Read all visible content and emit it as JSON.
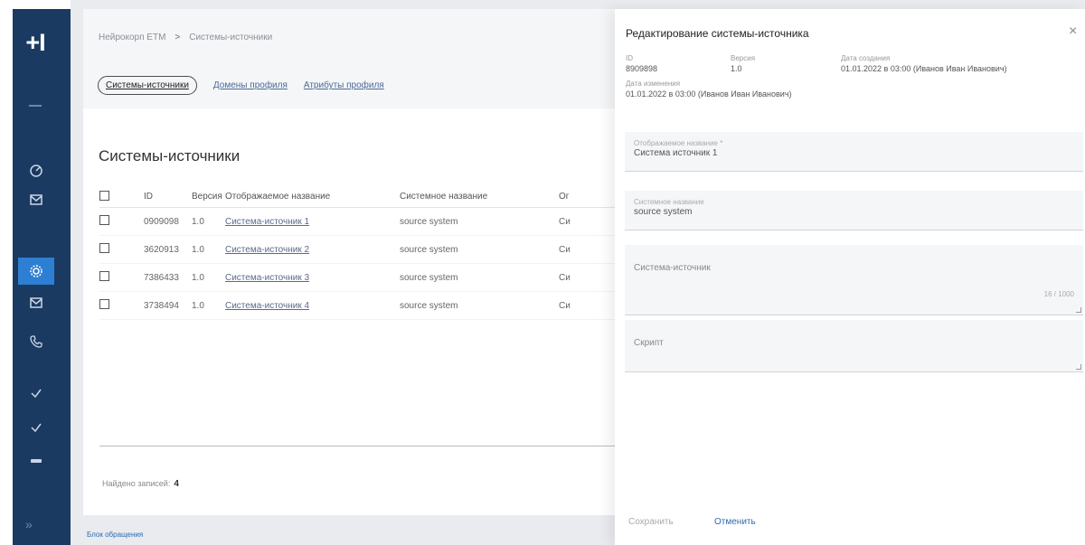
{
  "app": {
    "logo_text": "+I"
  },
  "sidebar": {
    "icons": [
      "dashboard-icon",
      "mail-icon",
      "settings-icon",
      "mail-icon",
      "phone-icon",
      "check-icon",
      "check-icon",
      "minus-icon"
    ],
    "active_index": 2,
    "expand_glyph": "»"
  },
  "breadcrumb": {
    "items": [
      "Нейрокорп ETM",
      "Системы-источники"
    ],
    "separator": ">"
  },
  "tabs": [
    {
      "label": "Системы-источники",
      "active": true
    },
    {
      "label": "Домены профиля",
      "active": false
    },
    {
      "label": "Атрибуты профиля",
      "active": false
    }
  ],
  "page": {
    "title": "Системы-источники"
  },
  "table": {
    "columns": [
      "ID",
      "Версия",
      "Отображаемое название",
      "Системное название",
      "Ог"
    ],
    "rows": [
      {
        "id": "0909098",
        "version": "1.0",
        "display": "Система-источник 1",
        "system": "source system",
        "more": "Си"
      },
      {
        "id": "3620913",
        "version": "1.0",
        "display": "Система-источник 2",
        "system": "source system",
        "more": "Си"
      },
      {
        "id": "7386433",
        "version": "1.0",
        "display": "Система-источник 3",
        "system": "source system",
        "more": "Си"
      },
      {
        "id": "3738494",
        "version": "1.0",
        "display": "Система-источник 4",
        "system": "source system",
        "more": "Си"
      }
    ]
  },
  "footer": {
    "found_label": "Найдено записей:",
    "found_count": "4",
    "link": "Блок обращения"
  },
  "panel": {
    "title": "Редактирование системы-источника",
    "close_glyph": "×",
    "meta": {
      "id_label": "ID",
      "id_value": "8909898",
      "version_label": "Версия",
      "version_value": "1.0",
      "created_label": "Дата создания",
      "created_value": "01.01.2022 в 03:00 (Иванов Иван Иванович)",
      "updated_label": "Дата изменения",
      "updated_value": "01.01.2022 в 03:00 (Иванов Иван Иванович)"
    },
    "fields": {
      "display_label": "Отображаемое название *",
      "display_value": "Система источник 1",
      "system_label": "Системное название",
      "system_value": "source system",
      "description_placeholder": "Система-источник",
      "description_counter": "16 / 1000",
      "comment_placeholder": "Скрипт"
    },
    "buttons": {
      "save": "Сохранить",
      "cancel": "Отменить"
    }
  }
}
